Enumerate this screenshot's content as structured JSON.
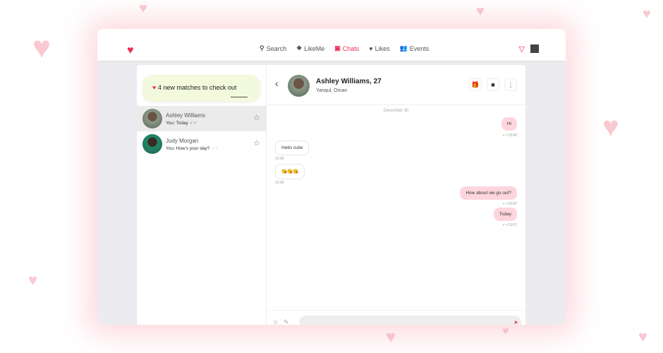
{
  "nav": {
    "items": [
      {
        "label": "Search",
        "icon": "search-icon"
      },
      {
        "label": "LikeMe",
        "icon": "likeme-icon"
      },
      {
        "label": "Chats",
        "icon": "chat-icon",
        "active": true
      },
      {
        "label": "Likes",
        "icon": "heart-icon"
      },
      {
        "label": "Events",
        "icon": "events-icon"
      }
    ]
  },
  "promo": {
    "text": "4 new matches to check out"
  },
  "chats": [
    {
      "name": "Ashley Williams",
      "preview": "You: Today",
      "read": true
    },
    {
      "name": "Judy Morgan",
      "preview": "You: How's your day?",
      "read": false
    }
  ],
  "header": {
    "name": "Ashley Williams, 27",
    "location": "Yanqul, Oman"
  },
  "date": "December 30",
  "messages": [
    {
      "text": "Hi",
      "time": "13:06",
      "dir": "out"
    },
    {
      "text": "Hello cutie",
      "time": "13:06",
      "dir": "in"
    },
    {
      "text": "😘😘😘",
      "time": "13:06",
      "dir": "in"
    },
    {
      "text": "How about we go out?",
      "time": "13:07",
      "dir": "out"
    },
    {
      "text": "Today",
      "time": "13:07",
      "dir": "out"
    }
  ],
  "colors": {
    "accent": "#ef2f55",
    "outgoing": "#fdd6dd",
    "promo": "#f3f9dc"
  }
}
